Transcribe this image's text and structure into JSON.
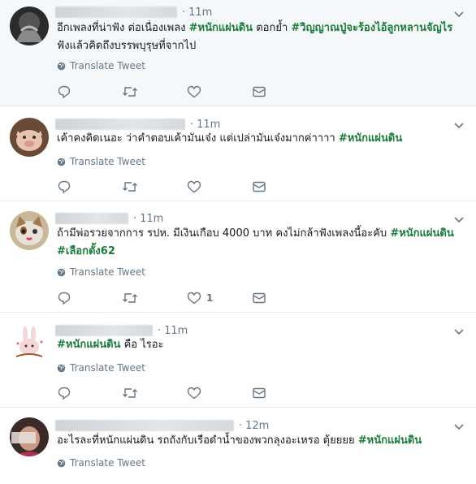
{
  "translate_label": "Translate Tweet",
  "colors": {
    "hashtag": "#1b7b3b",
    "meta": "#657786",
    "border": "#e6ecf0",
    "highlight_bg": "#f5f8fa"
  },
  "tweets": [
    {
      "time": "11m",
      "avatar": "avatar-dark-hands",
      "segments": [
        {
          "t": "อีกเพลงที่น่าฟัง ต่อเนื่องเพลง ",
          "tag": false
        },
        {
          "t": "#หนักแผ่นดิน",
          "tag": true
        },
        {
          "t": " ตอกย้ำ ",
          "tag": false
        },
        {
          "t": "#วิญญาณปู่จะร้องไอ้ลูกหลานจัญไร",
          "tag": true
        },
        {
          "t": " ฟังแล้วคิดถึงบรรพบุรุษที่จากไป",
          "tag": false
        }
      ],
      "like_count": ""
    },
    {
      "time": "11m",
      "avatar": "avatar-piglet",
      "segments": [
        {
          "t": "เค้าคงคิดเนอะ ว่าคำตอบเค้ามันเจ๋ง แต่เปล่ามันเจ๋งมากค่าาาา ",
          "tag": false
        },
        {
          "t": "#หนักแผ่นดิน",
          "tag": true
        }
      ],
      "like_count": ""
    },
    {
      "time": "11m",
      "avatar": "avatar-cat",
      "segments": [
        {
          "t": "ถ้ามีพ่อรวยจากการ รปห. มีเงินเกือบ 4000 บาท คงไม่กล้าฟังเพลงนี้อะคับ ",
          "tag": false
        },
        {
          "t": "#หนักแผ่นดิน",
          "tag": true
        },
        {
          "t": " ",
          "tag": false
        },
        {
          "t": "#เลือกตั้ง62",
          "tag": true
        }
      ],
      "like_count": "1"
    },
    {
      "time": "11m",
      "avatar": "avatar-bunny-sticker",
      "segments": [
        {
          "t": "#หนักแผ่นดิน",
          "tag": true
        },
        {
          "t": " คือ ไรอะ",
          "tag": false
        }
      ],
      "like_count": ""
    },
    {
      "time": "12m",
      "avatar": "avatar-person-blurred",
      "segments": [
        {
          "t": "อะไรละที่หนักแผ่นดิน รถถังกับเรือดำน้ำของพวกลุงอะเหรอ ตุ้ยยยย ",
          "tag": false
        },
        {
          "t": "#หนักแผ่นดิน",
          "tag": true
        }
      ],
      "like_count": ""
    }
  ]
}
